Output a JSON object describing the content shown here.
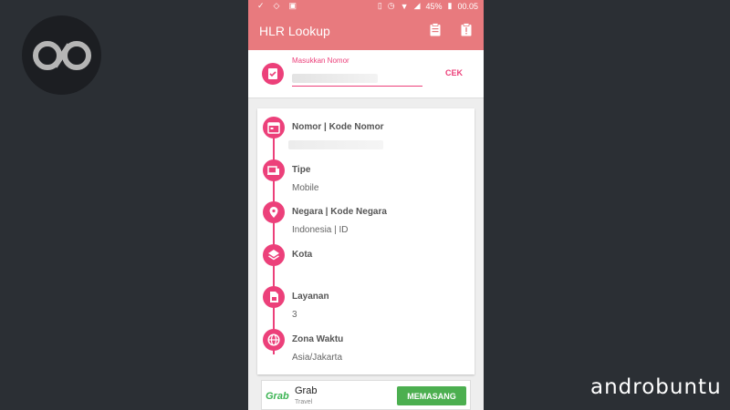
{
  "watermark": {
    "brand": "androbuntu",
    "logo_icon": "infinity-logo-icon"
  },
  "statusbar": {
    "battery": "45%",
    "time": "00.05",
    "icons": [
      "check-icon",
      "wifi-icon",
      "image-icon",
      "vibrate-icon",
      "alarm-icon",
      "signal-icon",
      "battery-icon"
    ]
  },
  "appbar": {
    "title": "HLR Lookup",
    "actions": [
      "clipboard-icon",
      "info-icon"
    ]
  },
  "input": {
    "label": "Masukkan Nomor",
    "value": "",
    "button": "CEK"
  },
  "details": [
    {
      "label": "Nomor | Kode Nomor",
      "value": "",
      "icon": "calendar-icon"
    },
    {
      "label": "Tipe",
      "value": "Mobile",
      "icon": "devices-icon"
    },
    {
      "label": "Negara | Kode Negara",
      "value": "Indonesia | ID",
      "icon": "location-pin-icon"
    },
    {
      "label": "Kota",
      "value": "",
      "icon": "layers-icon"
    },
    {
      "label": "Layanan",
      "value": "3",
      "icon": "sim-card-icon"
    },
    {
      "label": "Zona Waktu",
      "value": "Asia/Jakarta",
      "icon": "globe-icon"
    }
  ],
  "ad": {
    "logo": "Grab",
    "name": "Grab",
    "category": "Travel",
    "button": "MEMASANG"
  },
  "colors": {
    "primary": "#e87a7e",
    "accent": "#ec407a",
    "install": "#4caf50"
  }
}
